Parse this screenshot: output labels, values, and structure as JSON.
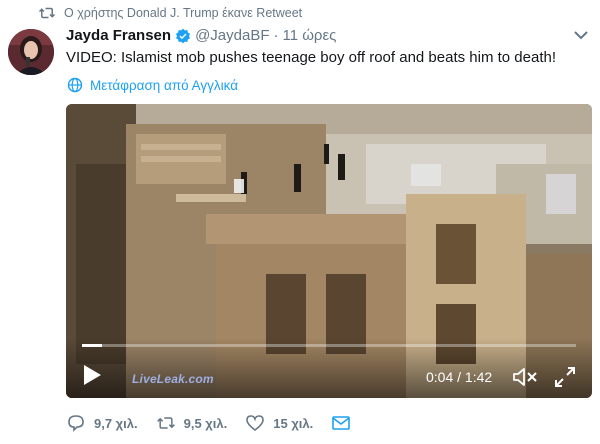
{
  "retweet_notice": {
    "icon": "retweet-icon",
    "text": "Ο χρήστης Donald J. Trump έκανε Retweet"
  },
  "tweet": {
    "author_name": "Jayda Fransen",
    "verified_icon": "verified-badge-icon",
    "handle": "@JaydaBF",
    "separator": "·",
    "time": "11 ώρες",
    "text": "VIDEO: Islamist mob pushes teenage boy off roof and beats him to death!",
    "translate_label": "Μετάφραση από Αγγλικά",
    "accent_color": "#1da1f2"
  },
  "video": {
    "watermark": "LiveLeak.com",
    "time_display": "0:04 / 1:42",
    "progress_fraction": 0.04,
    "play_icon": "play-icon",
    "mute_icon": "muted-speaker-icon",
    "fullscreen_icon": "fullscreen-icon"
  },
  "actions": {
    "reply_count": "9,7 χιλ.",
    "retweet_count": "9,5 χιλ.",
    "like_count": "15 χιλ.",
    "reply_icon": "reply-icon",
    "retweet_icon": "retweet-icon",
    "like_icon": "heart-icon",
    "dm_icon": "envelope-icon"
  }
}
